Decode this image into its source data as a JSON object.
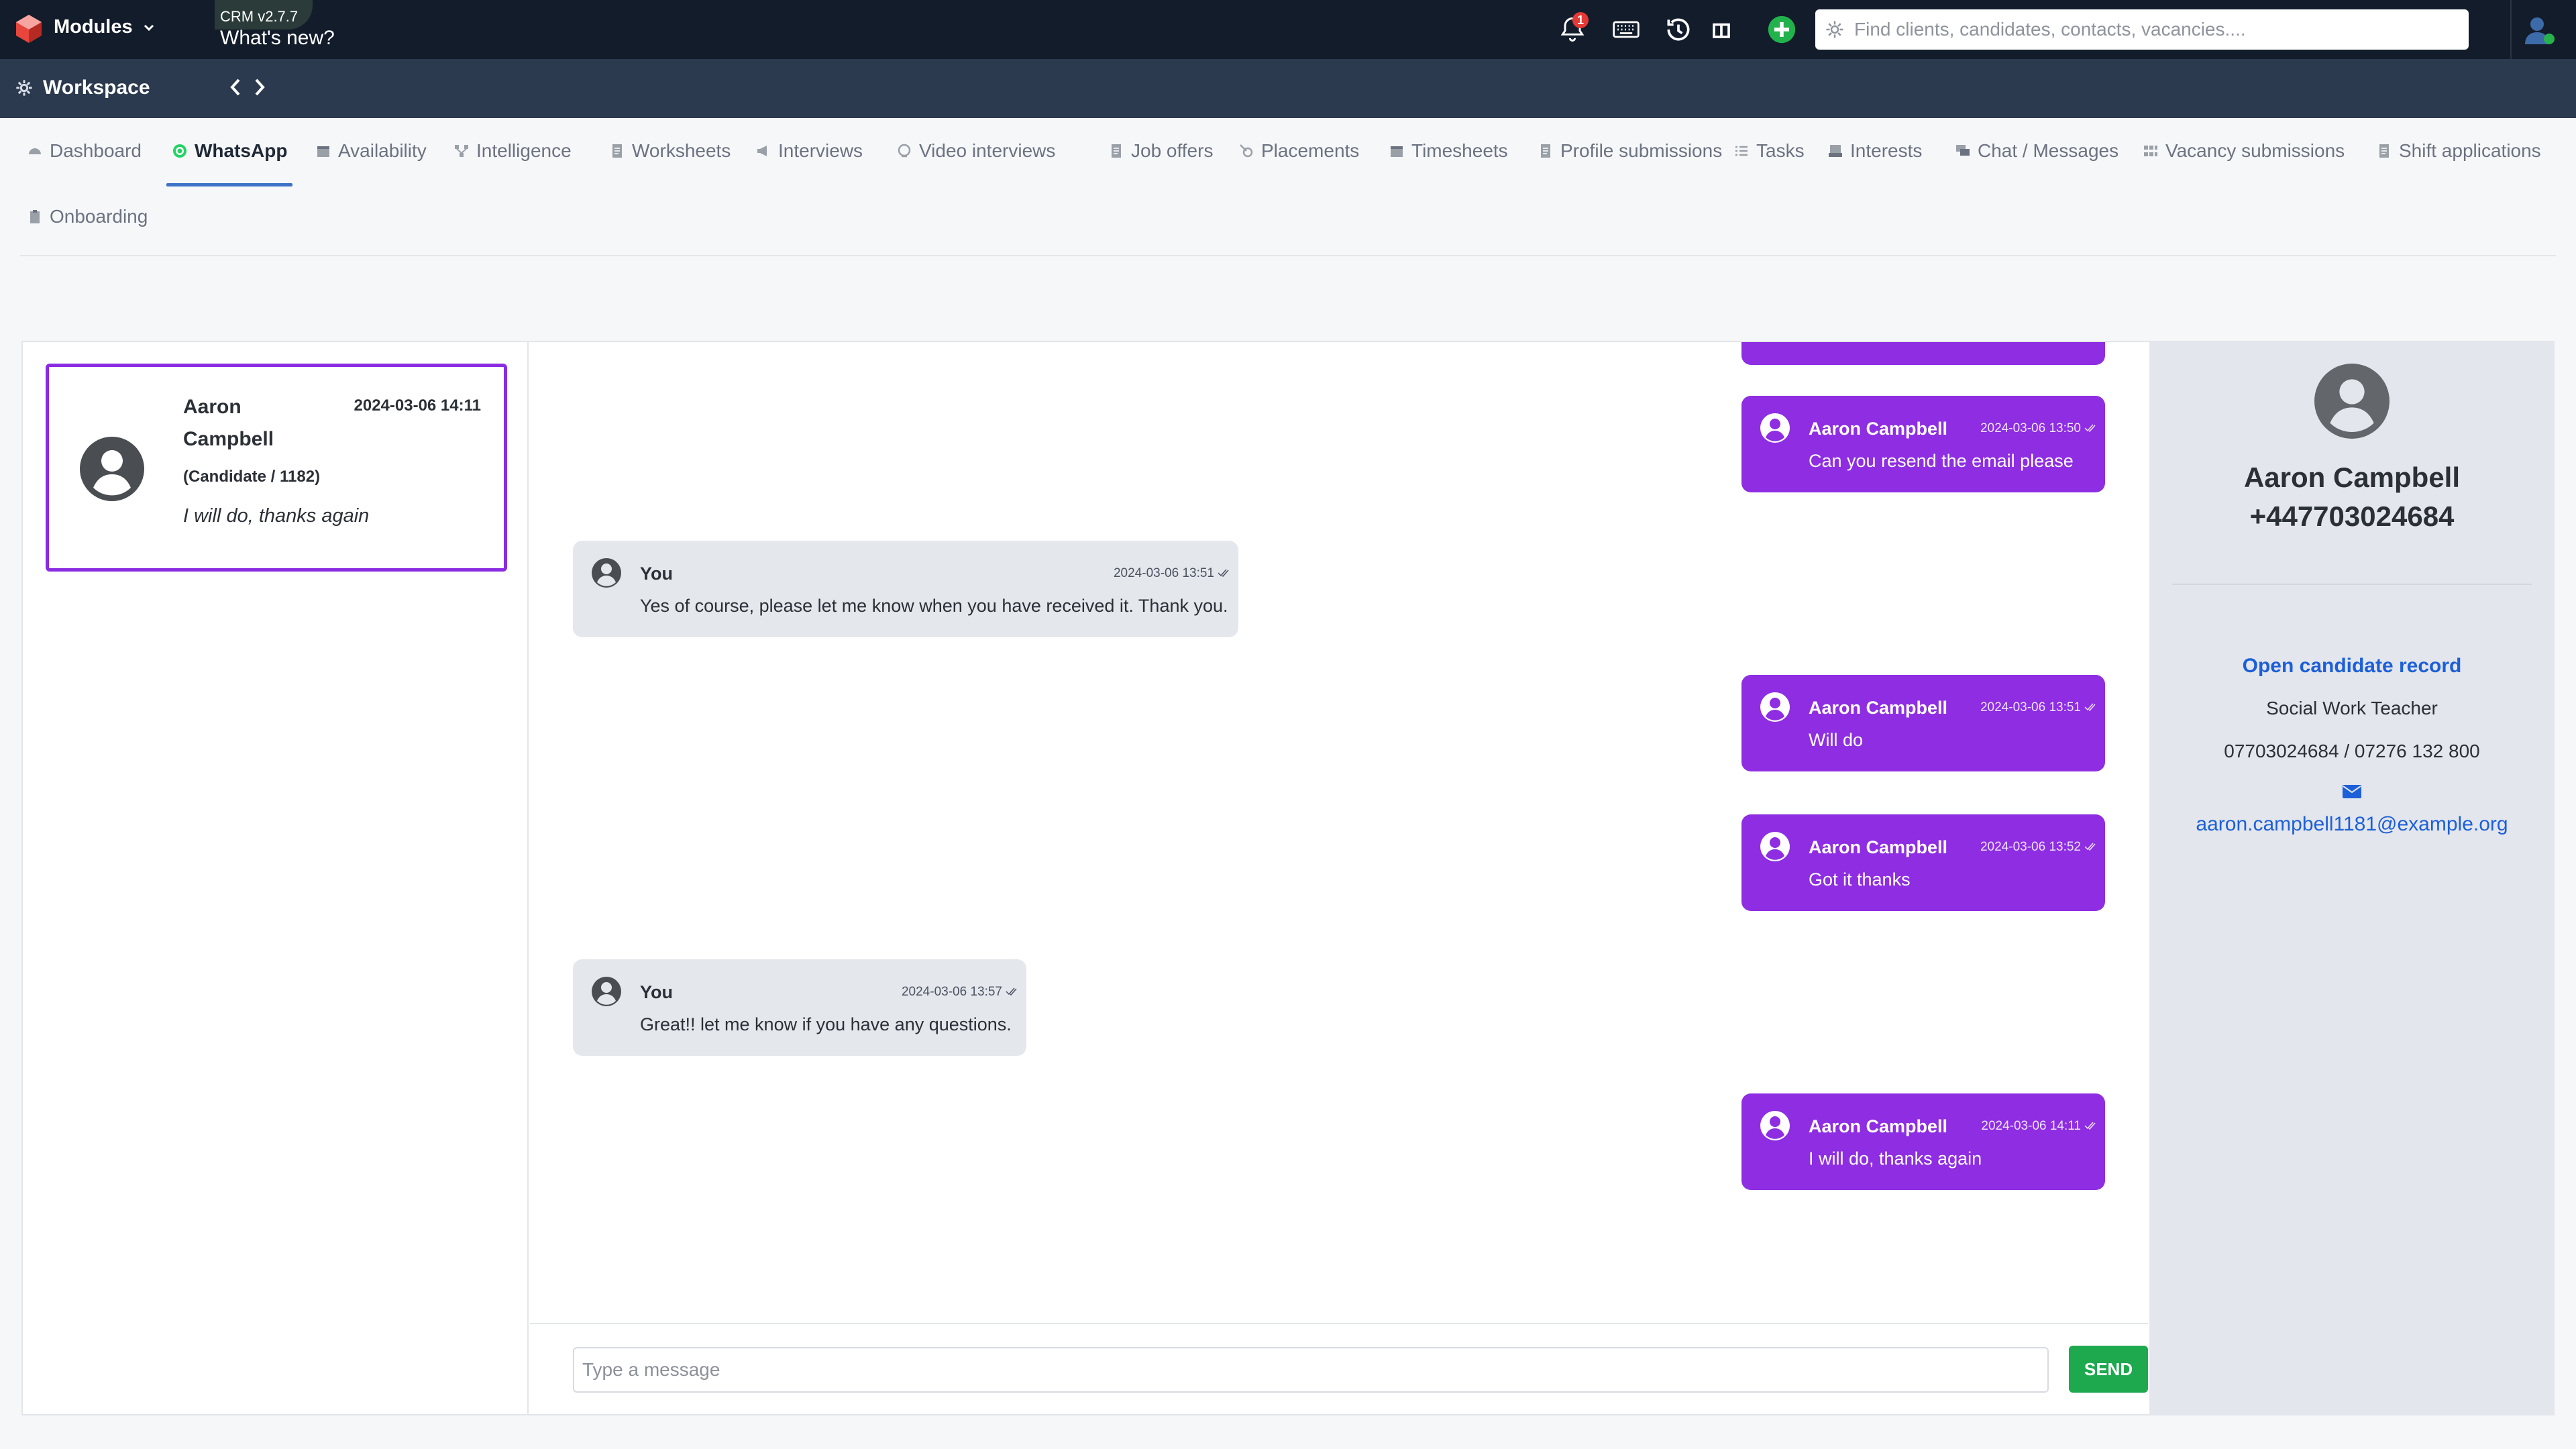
{
  "app": {
    "modules_label": "Modules",
    "version": "CRM v2.7.7",
    "whats_new": "What's new?",
    "notification_count": "1",
    "search_placeholder": "Find clients, candidates, contacts, vacancies....",
    "accent_color": "#8e2de2",
    "topbar_color": "#131c2b"
  },
  "workspace": {
    "title": "Workspace"
  },
  "tabs": [
    {
      "label": "Dashboard",
      "icon": "dashboard-icon"
    },
    {
      "label": "WhatsApp",
      "icon": "whatsapp-icon",
      "active": true
    },
    {
      "label": "Availability",
      "icon": "calendar-icon"
    },
    {
      "label": "Intelligence",
      "icon": "network-icon"
    },
    {
      "label": "Worksheets",
      "icon": "document-icon"
    },
    {
      "label": "Interviews",
      "icon": "megaphone-icon"
    },
    {
      "label": "Video interviews",
      "icon": "video-icon"
    },
    {
      "label": "Job offers",
      "icon": "document-icon"
    },
    {
      "label": "Placements",
      "icon": "target-icon"
    },
    {
      "label": "Timesheets",
      "icon": "calendar-icon"
    },
    {
      "label": "Profile submissions",
      "icon": "document-icon"
    },
    {
      "label": "Tasks",
      "icon": "list-icon"
    },
    {
      "label": "Interests",
      "icon": "inbox-icon"
    },
    {
      "label": "Chat / Messages",
      "icon": "chat-icon"
    },
    {
      "label": "Vacancy submissions",
      "icon": "grid-icon"
    },
    {
      "label": "Shift applications",
      "icon": "document-icon"
    },
    {
      "label": "Onboarding",
      "icon": "clipboard-icon"
    }
  ],
  "conversation": {
    "name": "Aaron Campbell",
    "time": "2024-03-06 14:11",
    "ref": "(Candidate / 1182)",
    "preview": "I will do, thanks again"
  },
  "messages": [
    {
      "direction": "in",
      "sender": "Aaron Campbell",
      "time": "2024-03-06 13:50",
      "text": "Can you resend the email please"
    },
    {
      "direction": "out",
      "sender": "You",
      "time": "2024-03-06 13:51",
      "text": "Yes of course, please let me know when you have received it. Thank you."
    },
    {
      "direction": "in",
      "sender": "Aaron Campbell",
      "time": "2024-03-06 13:51",
      "text": "Will do"
    },
    {
      "direction": "in",
      "sender": "Aaron Campbell",
      "time": "2024-03-06 13:52",
      "text": "Got it thanks"
    },
    {
      "direction": "out",
      "sender": "You",
      "time": "2024-03-06 13:57",
      "text": "Great!! let me know if you have any questions."
    },
    {
      "direction": "in",
      "sender": "Aaron Campbell",
      "time": "2024-03-06 14:11",
      "text": "I will do, thanks again"
    }
  ],
  "composer": {
    "placeholder": "Type a message",
    "send_label": "SEND"
  },
  "details": {
    "name": "Aaron Campbell",
    "phone": "+447703024684",
    "open_record": "Open candidate record",
    "job_title": "Social Work Teacher",
    "phones": "07703024684 / 07276 132 800",
    "email": "aaron.campbell1181@example.org"
  }
}
